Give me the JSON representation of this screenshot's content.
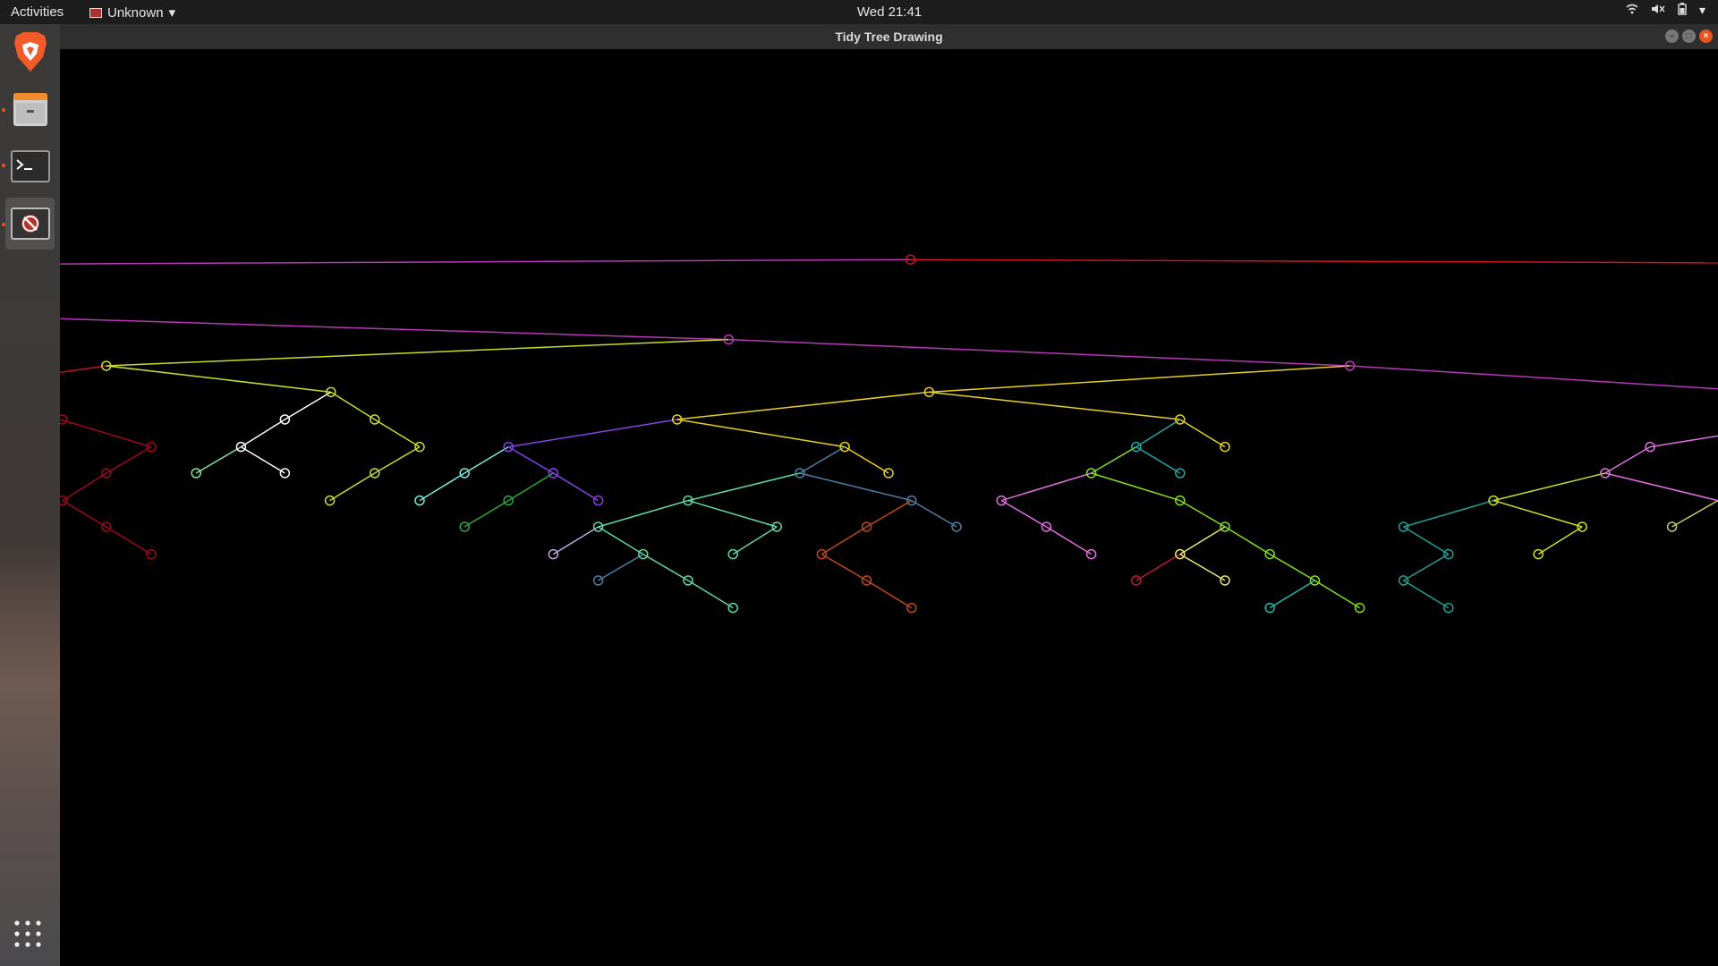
{
  "topbar": {
    "activities": "Activities",
    "app_menu": "Unknown",
    "clock": "Wed 21:41",
    "tray_icons": [
      "wifi-icon",
      "volume-muted-icon",
      "battery-icon",
      "system-menu-chevron-icon"
    ]
  },
  "dock": {
    "items": [
      "brave-browser-icon",
      "file-cabinet-icon",
      "terminal-icon",
      "tidy-tree-app-icon"
    ],
    "apps_grid": "show-applications-icon"
  },
  "window": {
    "title": "Tidy Tree Drawing"
  },
  "colors": {
    "background": "#000000",
    "accent": "#e95420"
  }
}
